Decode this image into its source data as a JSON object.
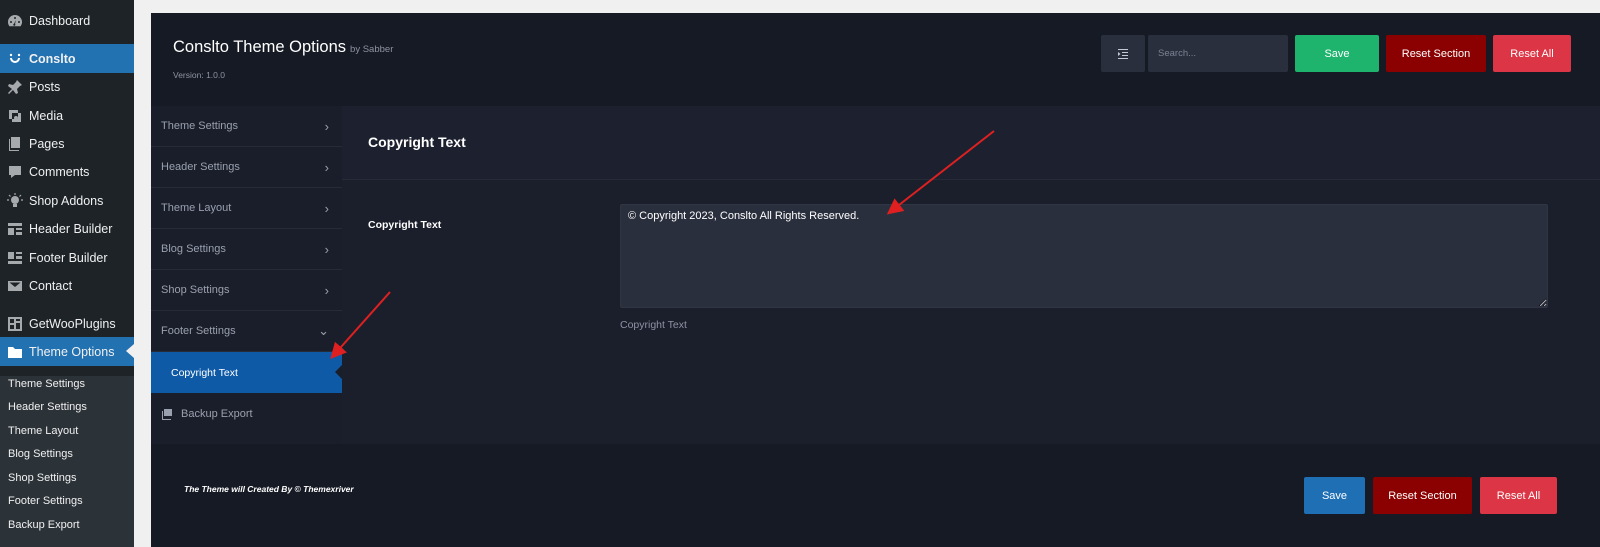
{
  "wp_menu": {
    "items": [
      {
        "label": "Dashboard",
        "icon": "dashboard-icon"
      },
      {
        "label": "Conslto",
        "icon": "smile-icon"
      },
      {
        "label": "Posts",
        "icon": "pin-icon"
      },
      {
        "label": "Media",
        "icon": "media-icon"
      },
      {
        "label": "Pages",
        "icon": "pages-icon"
      },
      {
        "label": "Comments",
        "icon": "comments-icon"
      },
      {
        "label": "Shop Addons",
        "icon": "lightbulb-icon"
      },
      {
        "label": "Header Builder",
        "icon": "header-builder-icon"
      },
      {
        "label": "Footer Builder",
        "icon": "footer-builder-icon"
      },
      {
        "label": "Contact",
        "icon": "mail-icon"
      },
      {
        "label": "GetWooPlugins",
        "icon": "plugin-grid-icon"
      },
      {
        "label": "Theme Options",
        "icon": "folder-icon"
      }
    ],
    "submenu": [
      "Theme Settings",
      "Header Settings",
      "Theme Layout",
      "Blog Settings",
      "Shop Settings",
      "Footer Settings",
      "Backup Export"
    ]
  },
  "header": {
    "title": "Conslto Theme Options",
    "by": "by Sabber",
    "version": "Version: 1.0.0",
    "search_placeholder": "Search...",
    "save_label": "Save",
    "reset_section_label": "Reset Section",
    "reset_all_label": "Reset All"
  },
  "nav": {
    "items": [
      "Theme Settings",
      "Header Settings",
      "Theme Layout",
      "Blog Settings",
      "Shop Settings",
      "Footer Settings"
    ],
    "active_sub": "Copyright Text",
    "backup": "Backup Export"
  },
  "content": {
    "section_title": "Copyright Text",
    "field_label": "Copyright Text",
    "field_value": "© Copyright 2023, Conslto All Rights Reserved.",
    "field_desc": "Copyright Text"
  },
  "footer": {
    "credit": "The Theme will Created By © Themexriver",
    "save_label": "Save",
    "reset_section_label": "Reset Section",
    "reset_all_label": "Reset All"
  },
  "colors": {
    "save_green": "#1fb46e",
    "save_blue": "#1f6fb5",
    "reset_section": "#8b0000",
    "reset_all": "#dc3545",
    "active_blue": "#0f5aa7",
    "annotation_red": "#e02020"
  }
}
